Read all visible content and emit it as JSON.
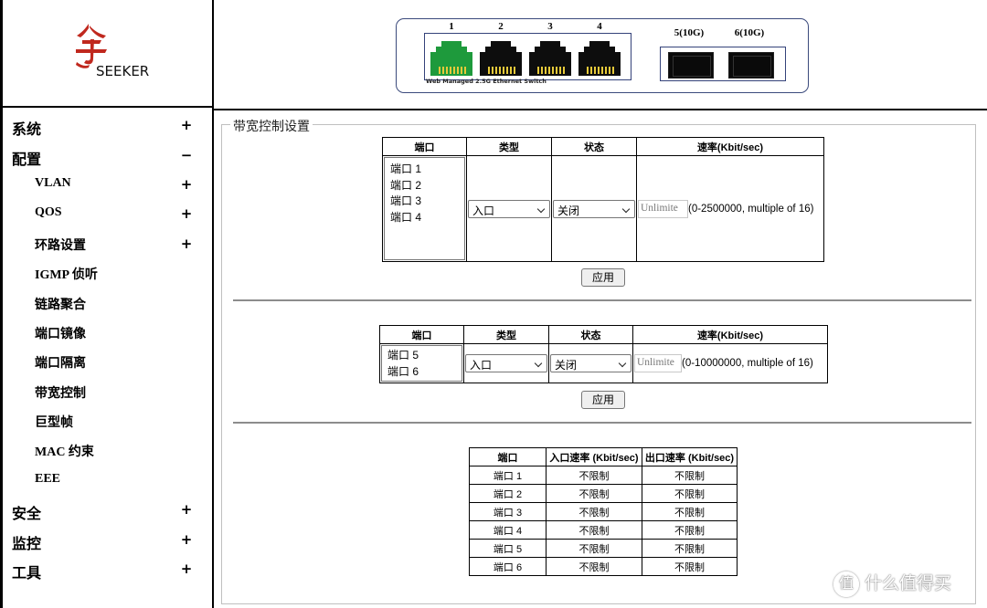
{
  "brand": {
    "logo_text": "SEEKER"
  },
  "sidebar": {
    "items": [
      {
        "label": "系统",
        "toggle": "+",
        "level": "top"
      },
      {
        "label": "配置",
        "toggle": "−",
        "level": "top"
      },
      {
        "label": "VLAN",
        "toggle": "+",
        "level": "sub"
      },
      {
        "label": "QOS",
        "toggle": "+",
        "level": "sub"
      },
      {
        "label": "环路设置",
        "toggle": "+",
        "level": "sub"
      },
      {
        "label": "IGMP 侦听",
        "toggle": "",
        "level": "sub"
      },
      {
        "label": "链路聚合",
        "toggle": "",
        "level": "sub"
      },
      {
        "label": "端口镜像",
        "toggle": "",
        "level": "sub"
      },
      {
        "label": "端口隔离",
        "toggle": "",
        "level": "sub"
      },
      {
        "label": "带宽控制",
        "toggle": "",
        "level": "sub"
      },
      {
        "label": "巨型帧",
        "toggle": "",
        "level": "sub"
      },
      {
        "label": "MAC 约束",
        "toggle": "",
        "level": "sub"
      },
      {
        "label": "EEE",
        "toggle": "",
        "level": "sub"
      },
      {
        "label": "安全",
        "toggle": "+",
        "level": "top"
      },
      {
        "label": "监控",
        "toggle": "+",
        "level": "top"
      },
      {
        "label": "工具",
        "toggle": "+",
        "level": "top"
      }
    ]
  },
  "switch_panel": {
    "ports": [
      "1",
      "2",
      "3",
      "4"
    ],
    "sfp_ports": [
      "5(10G)",
      "6(10G)"
    ],
    "caption": "Web Managed 2.5G Ethernet Switch",
    "active_port_color": "#1e9a3c"
  },
  "section": {
    "title": "带宽控制设置"
  },
  "table_headers": {
    "port": "端口",
    "type": "类型",
    "state": "状态",
    "rate": "速率(Kbit/sec)"
  },
  "form_2_5g": {
    "ports": [
      "端口 1",
      "端口 2",
      "端口 3",
      "端口 4"
    ],
    "type_value": "入口",
    "state_value": "关闭",
    "rate_placeholder": "Unlimite",
    "rate_hint": "(0-2500000, multiple of 16)",
    "apply_label": "应用"
  },
  "form_10g": {
    "ports": [
      "端口 5",
      "端口 6"
    ],
    "type_value": "入口",
    "state_value": "关闭",
    "rate_placeholder": "Unlimite",
    "rate_hint": "(0-10000000, multiple of 16)",
    "apply_label": "应用"
  },
  "status_table": {
    "headers": [
      "端口",
      "入口速率 (Kbit/sec)",
      "出口速率 (Kbit/sec)"
    ],
    "rows": [
      [
        "端口 1",
        "不限制",
        "不限制"
      ],
      [
        "端口 2",
        "不限制",
        "不限制"
      ],
      [
        "端口 3",
        "不限制",
        "不限制"
      ],
      [
        "端口 4",
        "不限制",
        "不限制"
      ],
      [
        "端口 5",
        "不限制",
        "不限制"
      ],
      [
        "端口 6",
        "不限制",
        "不限制"
      ]
    ]
  },
  "watermark": {
    "badge": "值",
    "text": "什么值得买"
  }
}
